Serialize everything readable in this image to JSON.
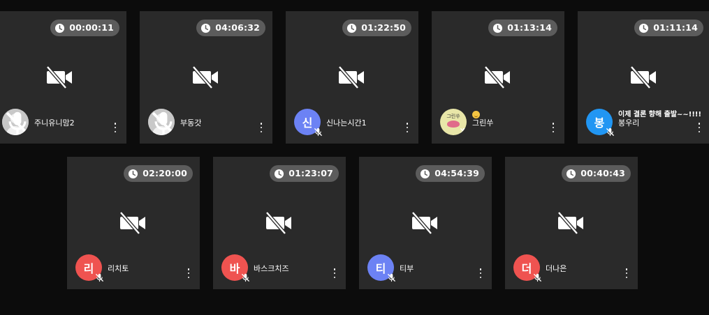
{
  "participants": [
    {
      "timer": "00:00:11",
      "name": "주니유니맘2",
      "avatar_type": "person",
      "initial": "",
      "avatar_color": "#c8c8c8",
      "status": ""
    },
    {
      "timer": "04:06:32",
      "name": "부동갓",
      "avatar_type": "person",
      "initial": "",
      "avatar_color": "#c8c8c8",
      "status": ""
    },
    {
      "timer": "01:22:50",
      "name": "신나는시간1",
      "avatar_type": "initial",
      "initial": "신",
      "avatar_color": "#6c82f4",
      "status": ""
    },
    {
      "timer": "01:13:14",
      "name": "그린쑤",
      "avatar_type": "sticker",
      "initial": "",
      "sticker_text": "그린쑤",
      "avatar_color": "#e8e6a8",
      "status": "",
      "emoji": "smile-emoji"
    },
    {
      "timer": "01:11:14",
      "name": "봉우리",
      "avatar_type": "initial",
      "initial": "봉",
      "avatar_color": "#2196f3",
      "status": "이제 결론 향해 출발~~!!!!"
    },
    {
      "timer": "02:20:00",
      "name": "리치토",
      "avatar_type": "initial",
      "initial": "리",
      "avatar_color": "#ef5350",
      "status": ""
    },
    {
      "timer": "01:23:07",
      "name": "바스크치즈",
      "avatar_type": "initial",
      "initial": "바",
      "avatar_color": "#ef5350",
      "status": ""
    },
    {
      "timer": "04:54:39",
      "name": "티부",
      "avatar_type": "initial",
      "initial": "티",
      "avatar_color": "#6c82f4",
      "status": ""
    },
    {
      "timer": "00:40:43",
      "name": "더나은",
      "avatar_type": "initial",
      "initial": "더",
      "avatar_color": "#ef5350",
      "status": ""
    }
  ],
  "icons": {
    "timer": "clock-icon",
    "camera": "video-off-icon",
    "mic": "mic-off-icon",
    "menu": "more-vertical-icon"
  }
}
